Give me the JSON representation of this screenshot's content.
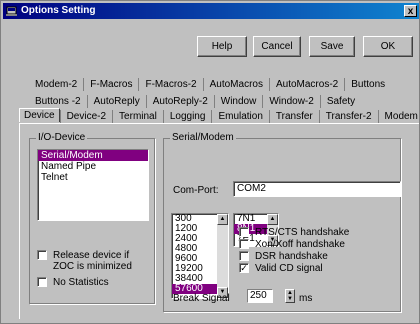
{
  "window": {
    "title": "Options Setting",
    "close": "x"
  },
  "toolbar": {
    "help": "Help",
    "cancel": "Cancel",
    "save": "Save",
    "ok": "OK"
  },
  "tabs": {
    "row1": [
      "Modem-2",
      "F-Macros",
      "F-Macros-2",
      "AutoMacros",
      "AutoMacros-2",
      "Buttons"
    ],
    "row2": [
      "Buttons -2",
      "AutoReply",
      "AutoReply-2",
      "Window",
      "Window-2",
      "Safety"
    ],
    "row3": [
      "Device",
      "Device-2",
      "Terminal",
      "Logging",
      "Emulation",
      "Transfer",
      "Transfer-2",
      "Modem"
    ],
    "active": "Device"
  },
  "io_device": {
    "title": "I/O-Device",
    "items": [
      "Serial/Modem",
      "Named Pipe",
      "Telnet"
    ],
    "selected": "Serial/Modem",
    "release_label": "Release device if ZOC is minimized",
    "release_checked": false,
    "nostats_label": "No Statistics",
    "nostats_checked": false
  },
  "serial": {
    "title": "Serial/Modem",
    "comport_label": "Com-Port:",
    "comport_value": "COM2",
    "baud_rates": [
      "300",
      "1200",
      "2400",
      "4800",
      "9600",
      "19200",
      "38400",
      "57600"
    ],
    "baud_selected": "57600",
    "parity": [
      "7N1",
      "8N1",
      "7E1"
    ],
    "parity_selected": "8N1",
    "rts_label": "RTS/CTS handshake",
    "xon_label": "Xon/Xoff handshake",
    "dsr_label": "DSR handshake",
    "valid_label": "Valid CD signal",
    "rts_checked": false,
    "xon_checked": false,
    "dsr_checked": false,
    "valid_checked": true,
    "break_label": "Break Signal",
    "break_value": "250",
    "break_unit": "ms"
  }
}
